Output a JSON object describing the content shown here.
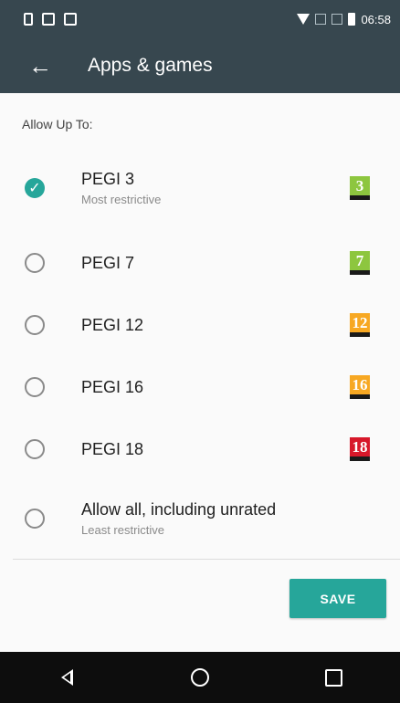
{
  "status_bar": {
    "time": "06:58"
  },
  "app_bar": {
    "title": "Apps & games",
    "back_icon": "arrow-left-icon"
  },
  "section_label": "Allow Up To:",
  "options": [
    {
      "label": "PEGI 3",
      "sub": "Most restrictive",
      "badge": "3",
      "badge_color": "#8dc63f",
      "selected": true
    },
    {
      "label": "PEGI 7",
      "sub": "",
      "badge": "7",
      "badge_color": "#8dc63f",
      "selected": false
    },
    {
      "label": "PEGI 12",
      "sub": "",
      "badge": "12",
      "badge_color": "#f7a823",
      "selected": false
    },
    {
      "label": "PEGI 16",
      "sub": "",
      "badge": "16",
      "badge_color": "#f7a823",
      "selected": false
    },
    {
      "label": "PEGI 18",
      "sub": "",
      "badge": "18",
      "badge_color": "#d7182a",
      "selected": false
    },
    {
      "label": "Allow all, including unrated",
      "sub": "Least restrictive",
      "badge": "",
      "badge_color": "",
      "selected": false
    }
  ],
  "save_label": "SAVE",
  "colors": {
    "accent": "#26a69a",
    "toolbar": "#37474f"
  }
}
